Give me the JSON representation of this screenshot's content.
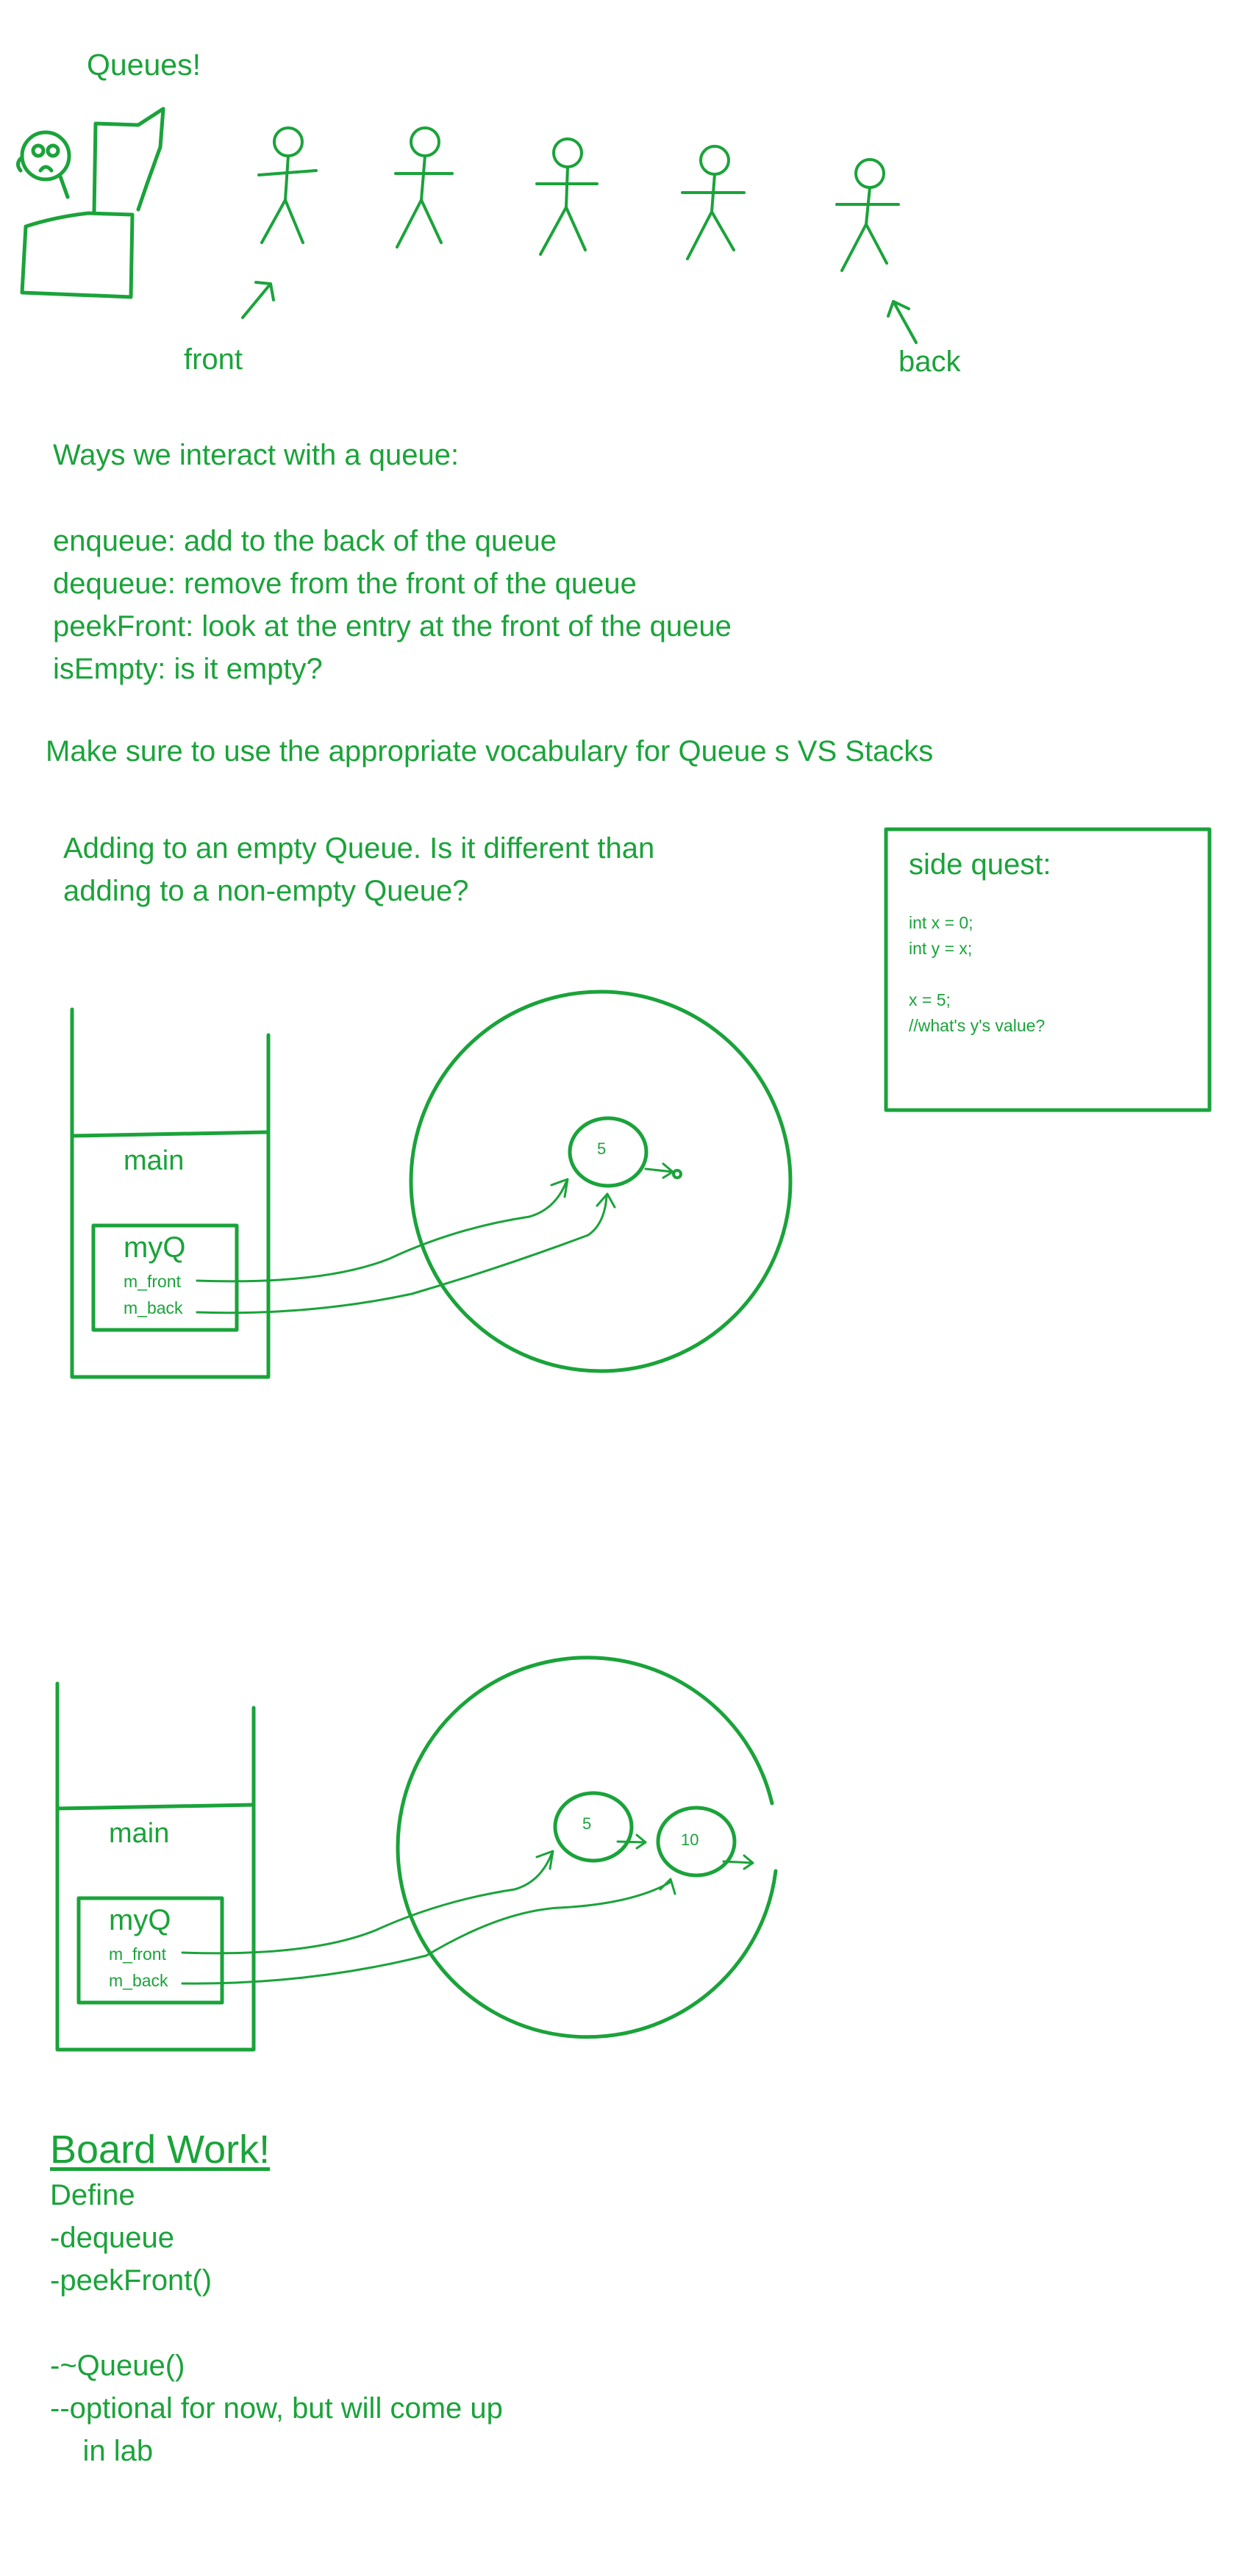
{
  "heading": "Queues!",
  "labels": {
    "front": "front",
    "back": "back"
  },
  "interactions": {
    "title": "Ways we interact with a queue:",
    "items": [
      "enqueue: add to the back of the queue",
      "dequeue: remove from the front of the queue",
      "peekFront: look at the entry at the front of the queue",
      "isEmpty: is it empty?"
    ]
  },
  "vocab_note": "Make sure to use the appropriate vocabulary for Queue s VS Stacks",
  "question": [
    "Adding to an empty Queue. Is it different than",
    "adding to a non-empty Queue?"
  ],
  "side_quest": {
    "title": "side quest:",
    "lines": [
      "int x = 0;",
      "int y = x;",
      "",
      "x = 5;",
      "//what's y's value?"
    ]
  },
  "diagram1": {
    "frame": "main",
    "object": "myQ",
    "fields": [
      "m_front",
      "m_back"
    ],
    "nodes": [
      "5"
    ]
  },
  "diagram2": {
    "frame": "main",
    "object": "myQ",
    "fields": [
      "m_front",
      "m_back"
    ],
    "nodes": [
      "5",
      "10"
    ]
  },
  "board_work": {
    "title": "Board Work!",
    "lines": [
      "Define",
      "-dequeue",
      "-peekFront()",
      "",
      "-~Queue()",
      "--optional for now, but will come up",
      "    in lab"
    ]
  },
  "colors": {
    "ink": "#1aa33a",
    "background": "#ffffff"
  }
}
